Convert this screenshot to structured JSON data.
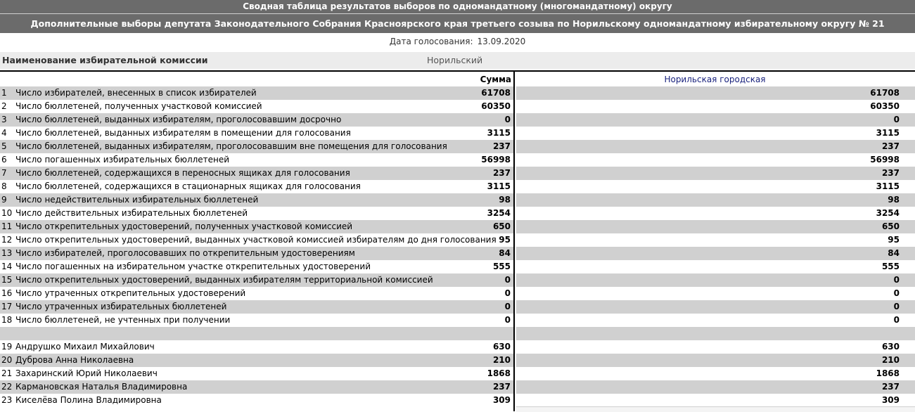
{
  "header": {
    "title": "Сводная таблица результатов выборов по одномандатному (многомандатному) округу",
    "subtitle": "Дополнительные выборы депутата Законодательного Собрания Красноярского края третьего созыва по Норильскому одномандатному избирательному округу № 21",
    "date_label": "Дата голосования:",
    "date_value": "13.09.2020"
  },
  "commission": {
    "label": "Наименование избирательной комиссии",
    "value": "Норильский"
  },
  "table": {
    "sum_header": "Сумма",
    "column_header": "Норильская городская",
    "rows": [
      {
        "n": "1",
        "label": "Число избирателей, внесенных в список избирателей",
        "sum": "61708",
        "val": "61708"
      },
      {
        "n": "2",
        "label": "Число бюллетеней, полученных участковой комиссией",
        "sum": "60350",
        "val": "60350"
      },
      {
        "n": "3",
        "label": "Число бюллетеней, выданных избирателям, проголосовавшим досрочно",
        "sum": "0",
        "val": "0"
      },
      {
        "n": "4",
        "label": "Число бюллетеней, выданных избирателям в помещении для голосования",
        "sum": "3115",
        "val": "3115"
      },
      {
        "n": "5",
        "label": "Число бюллетеней, выданных избирателям, проголосовавшим вне помещения для голосования",
        "sum": "237",
        "val": "237"
      },
      {
        "n": "6",
        "label": "Число погашенных избирательных бюллетеней",
        "sum": "56998",
        "val": "56998"
      },
      {
        "n": "7",
        "label": "Число бюллетеней, содержащихся в переносных ящиках для голосования",
        "sum": "237",
        "val": "237"
      },
      {
        "n": "8",
        "label": "Число бюллетеней, содержащихся в стационарных ящиках для голосования",
        "sum": "3115",
        "val": "3115"
      },
      {
        "n": "9",
        "label": "Число недействительных избирательных бюллетеней",
        "sum": "98",
        "val": "98"
      },
      {
        "n": "10",
        "label": "Число действительных избирательных бюллетеней",
        "sum": "3254",
        "val": "3254"
      },
      {
        "n": "11",
        "label": "Число открепительных удостоверений, полученных участковой комиссией",
        "sum": "650",
        "val": "650"
      },
      {
        "n": "12",
        "label": "Число открепительных удостоверений, выданных участковой комиссией избирателям до дня голосования",
        "sum": "95",
        "val": "95"
      },
      {
        "n": "13",
        "label": "Число избирателей, проголосовавших по открепительным удостоверениям",
        "sum": "84",
        "val": "84"
      },
      {
        "n": "14",
        "label": "Число погашенных на избирательном участке открепительных удостоверений",
        "sum": "555",
        "val": "555"
      },
      {
        "n": "15",
        "label": "Число открепительных удостоверений, выданных избирателям территориальной комиссией",
        "sum": "0",
        "val": "0"
      },
      {
        "n": "16",
        "label": "Число утраченных открепительных удостоверений",
        "sum": "0",
        "val": "0"
      },
      {
        "n": "17",
        "label": "Число утраченных избирательных бюллетеней",
        "sum": "0",
        "val": "0"
      },
      {
        "n": "18",
        "label": "Число бюллетеней, не учтенных при получении",
        "sum": "0",
        "val": "0"
      },
      {
        "n": "",
        "label": "",
        "sum": "",
        "val": ""
      },
      {
        "n": "19",
        "label": "Андрушко Михаил Михайлович",
        "sum": "630",
        "val": "630"
      },
      {
        "n": "20",
        "label": "Дуброва Анна Николаевна",
        "sum": "210",
        "val": "210"
      },
      {
        "n": "21",
        "label": "Захаринский Юрий Николаевич",
        "sum": "1868",
        "val": "1868"
      },
      {
        "n": "22",
        "label": "Кармановская Наталья Владимировна",
        "sum": "237",
        "val": "237"
      },
      {
        "n": "23",
        "label": "Киселёва Полина Владимировна",
        "sum": "309",
        "val": "309"
      }
    ]
  }
}
